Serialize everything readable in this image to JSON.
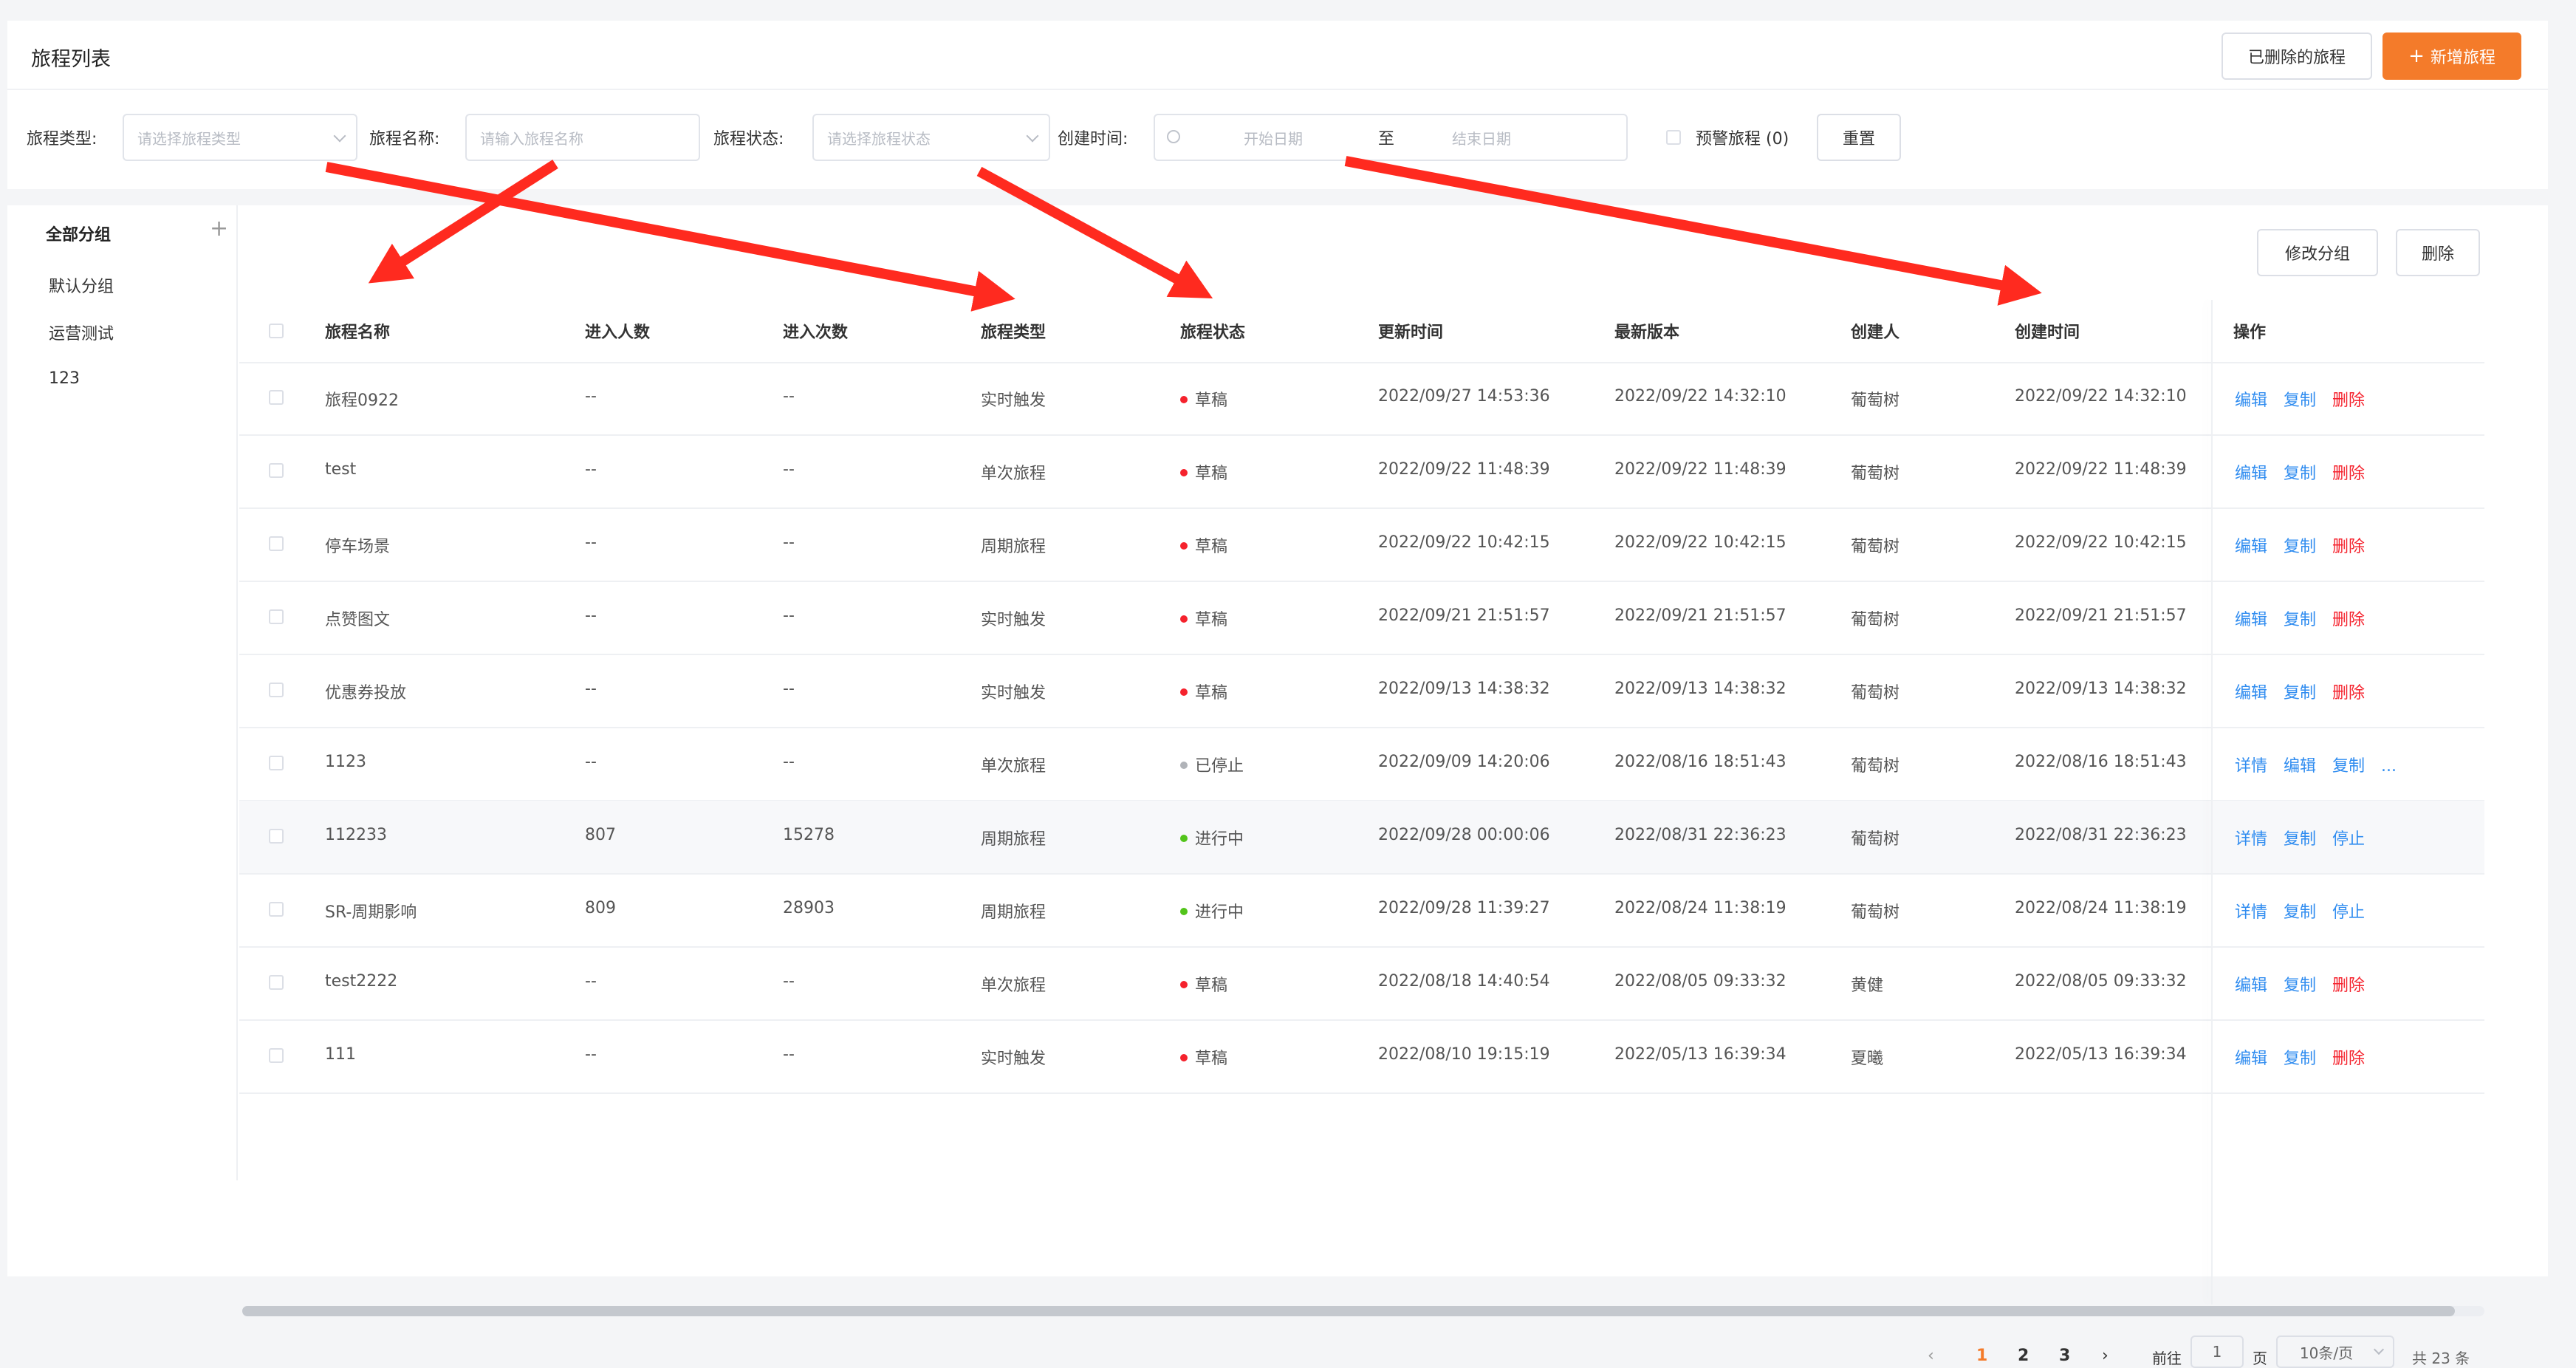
{
  "header": {
    "title": "旅程列表",
    "deleted_button": "已删除的旅程",
    "add_button": "新增旅程",
    "add_icon": "plus-icon"
  },
  "filters": {
    "type_label": "旅程类型:",
    "type_placeholder": "请选择旅程类型",
    "name_label": "旅程名称:",
    "name_placeholder": "请输入旅程名称",
    "status_label": "旅程状态:",
    "status_placeholder": "请选择旅程状态",
    "time_label": "创建时间:",
    "start_placeholder": "开始日期",
    "range_sep": "至",
    "end_placeholder": "结束日期",
    "warning_label": "预警旅程 (0)",
    "reset_button": "重置"
  },
  "sidebar": {
    "items": [
      {
        "label": "全部分组"
      },
      {
        "label": "默认分组"
      },
      {
        "label": "运营测试"
      },
      {
        "label": "123"
      }
    ]
  },
  "toolbar": {
    "edit_group": "修改分组",
    "delete": "删除"
  },
  "table": {
    "headers": [
      "旅程名称",
      "进入人数",
      "进入次数",
      "旅程类型",
      "旅程状态",
      "更新时间",
      "最新版本",
      "创建人",
      "创建时间",
      "操作"
    ],
    "rows": [
      {
        "name": "旅程0922",
        "users": "--",
        "times": "--",
        "type": "实时触发",
        "status": "草稿",
        "updated": "2022/09/27 14:53:36",
        "version": "2022/09/22 14:32:10",
        "creator": "葡萄树",
        "created": "2022/09/22 14:32:10",
        "a1": "编辑",
        "a2": "复制",
        "a3": "删除"
      },
      {
        "name": "test",
        "users": "--",
        "times": "--",
        "type": "单次旅程",
        "status": "草稿",
        "updated": "2022/09/22 11:48:39",
        "version": "2022/09/22 11:48:39",
        "creator": "葡萄树",
        "created": "2022/09/22 11:48:39",
        "a1": "编辑",
        "a2": "复制",
        "a3": "删除"
      },
      {
        "name": "停车场景",
        "users": "--",
        "times": "--",
        "type": "周期旅程",
        "status": "草稿",
        "updated": "2022/09/22 10:42:15",
        "version": "2022/09/22 10:42:15",
        "creator": "葡萄树",
        "created": "2022/09/22 10:42:15",
        "a1": "编辑",
        "a2": "复制",
        "a3": "删除"
      },
      {
        "name": "点赞图文",
        "users": "--",
        "times": "--",
        "type": "实时触发",
        "status": "草稿",
        "updated": "2022/09/21 21:51:57",
        "version": "2022/09/21 21:51:57",
        "creator": "葡萄树",
        "created": "2022/09/21 21:51:57",
        "a1": "编辑",
        "a2": "复制",
        "a3": "删除"
      },
      {
        "name": "优惠券投放",
        "users": "--",
        "times": "--",
        "type": "实时触发",
        "status": "草稿",
        "updated": "2022/09/13 14:38:32",
        "version": "2022/09/13 14:38:32",
        "creator": "葡萄树",
        "created": "2022/09/13 14:38:32",
        "a1": "编辑",
        "a2": "复制",
        "a3": "删除"
      },
      {
        "name": "1123",
        "users": "--",
        "times": "--",
        "type": "单次旅程",
        "status": "已停止",
        "updated": "2022/09/09 14:20:06",
        "version": "2022/08/16 18:51:43",
        "creator": "葡萄树",
        "created": "2022/08/16 18:51:43",
        "a1": "详情",
        "a2": "编辑",
        "a3": "复制",
        "more": "..."
      },
      {
        "name": "112233",
        "users": "807",
        "times": "15278",
        "type": "周期旅程",
        "status": "进行中",
        "updated": "2022/09/28 00:00:06",
        "version": "2022/08/31 22:36:23",
        "creator": "葡萄树",
        "created": "2022/08/31 22:36:23",
        "a1": "详情",
        "a2": "复制",
        "a3": "停止"
      },
      {
        "name": "SR-周期影响",
        "users": "809",
        "times": "28903",
        "type": "周期旅程",
        "status": "进行中",
        "updated": "2022/09/28 11:39:27",
        "version": "2022/08/24 11:38:19",
        "creator": "葡萄树",
        "created": "2022/08/24 11:38:19",
        "a1": "详情",
        "a2": "复制",
        "a3": "停止"
      },
      {
        "name": "test2222",
        "users": "--",
        "times": "--",
        "type": "单次旅程",
        "status": "草稿",
        "updated": "2022/08/18 14:40:54",
        "version": "2022/08/05 09:33:32",
        "creator": "黄健",
        "created": "2022/08/05 09:33:32",
        "a1": "编辑",
        "a2": "复制",
        "a3": "删除"
      },
      {
        "name": "111",
        "users": "--",
        "times": "--",
        "type": "实时触发",
        "status": "草稿",
        "updated": "2022/08/10 19:15:19",
        "version": "2022/05/13 16:39:34",
        "creator": "夏曦",
        "created": "2022/05/13 16:39:34",
        "a1": "编辑",
        "a2": "复制",
        "a3": "删除"
      }
    ]
  },
  "status_colors": {
    "草稿": "#f5222d",
    "已停止": "#b0b3b8",
    "进行中": "#52c41a"
  },
  "action_colors": {
    "default": "#2f8cf0",
    "danger": "#f5222d"
  },
  "pagination": {
    "pages": [
      "1",
      "2",
      "3"
    ],
    "current": "1",
    "goto_label": "前往",
    "goto_value": "1",
    "page_unit": "页",
    "page_size": "10条/页",
    "total": "共 23 条"
  },
  "annotations": {
    "arrow_color": "#ff2a1f"
  }
}
